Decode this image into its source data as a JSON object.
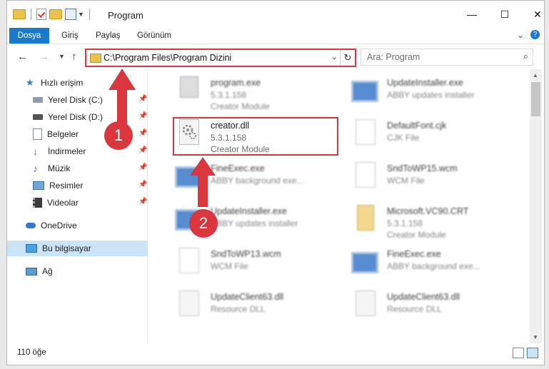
{
  "window": {
    "title": "Program",
    "minimize": "—",
    "maximize": "☐",
    "close": "✕"
  },
  "ribbon": {
    "tabs": [
      "Dosya",
      "Giriş",
      "Paylaş",
      "Görünüm"
    ]
  },
  "address": {
    "path": "C:\\Program Files\\Program Dizini",
    "search_placeholder": "Ara: Program"
  },
  "sidebar": {
    "items": [
      {
        "label": "Hızlı erişim",
        "icon": "star-icon"
      },
      {
        "label": "Yerel Disk (C:)",
        "icon": "drive-icon",
        "pinned": true
      },
      {
        "label": "Yerel Disk (D:)",
        "icon": "drive-icon",
        "pinned": true
      },
      {
        "label": "Belgeler",
        "icon": "documents-icon",
        "pinned": true
      },
      {
        "label": "İndirmeler",
        "icon": "download-icon",
        "pinned": true
      },
      {
        "label": "Müzik",
        "icon": "music-icon",
        "pinned": true
      },
      {
        "label": "Resimler",
        "icon": "pictures-icon",
        "pinned": true
      },
      {
        "label": "Videolar",
        "icon": "videos-icon",
        "pinned": true
      },
      {
        "label": "OneDrive",
        "icon": "cloud-icon"
      },
      {
        "label": "Bu bilgisayar",
        "icon": "computer-icon",
        "selected": true
      },
      {
        "label": "Ağ",
        "icon": "network-icon"
      }
    ]
  },
  "files": [
    {
      "name": "program.exe",
      "line2": "5.3.1.158",
      "line3": "Creator Module",
      "icon": "exe-icon"
    },
    {
      "name": "UpdateInstaller.exe",
      "line2": "ABBY updates installer",
      "line3": "",
      "icon": "app-icon"
    },
    {
      "name": "creator.dll",
      "line2": "5.3.1.158",
      "line3": "Creator Module",
      "icon": "dll-gear-icon"
    },
    {
      "name": "DefaultFont.cjk",
      "line2": "CJK File",
      "line3": "",
      "icon": "document-icon"
    },
    {
      "name": "FineExec.exe",
      "line2": "ABBY background exe...",
      "line3": "",
      "icon": "app-icon"
    },
    {
      "name": "SndToWP15.wcm",
      "line2": "WCM File",
      "line3": "",
      "icon": "document-icon"
    },
    {
      "name": "UpdateInstaller.exe",
      "line2": "ABBY updates installer",
      "line3": "",
      "icon": "app-icon"
    },
    {
      "name": "Microsoft.VC90.CRT",
      "line2": "5.3.1.158",
      "line3": "Creator Module",
      "icon": "zip-icon"
    },
    {
      "name": "SndToWP13.wcm",
      "line2": "WCM File",
      "line3": "",
      "icon": "document-icon"
    },
    {
      "name": "FineExec.exe",
      "line2": "ABBY background exe...",
      "line3": "",
      "icon": "app-icon"
    },
    {
      "name": "UpdateClient63.dll",
      "line2": "Resource DLL",
      "line3": "",
      "icon": "dll-icon"
    },
    {
      "name": "UpdateClient63.dll",
      "line2": "Resource DLL",
      "line3": "",
      "icon": "dll-icon"
    }
  ],
  "status": {
    "count": "110 öğe"
  },
  "annotations": [
    "1",
    "2"
  ],
  "colors": {
    "accent": "#1979ca",
    "highlight": "#d9363e",
    "selected": "#cce4f7"
  }
}
